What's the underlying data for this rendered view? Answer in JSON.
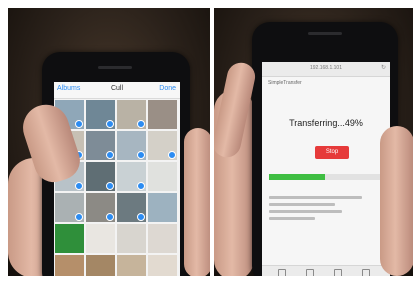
{
  "left_panel": {
    "nav": {
      "back_label": "Albums",
      "title": "Cull",
      "done_label": "Done"
    },
    "accent_color": "#2c8cf2",
    "photos": [
      {
        "color": "#8fa7b8",
        "checked": true
      },
      {
        "color": "#6f8796",
        "checked": true
      },
      {
        "color": "#b9b2a5",
        "checked": true
      },
      {
        "color": "#9a8f86",
        "checked": false
      },
      {
        "color": "#c7c0b4",
        "checked": true
      },
      {
        "color": "#7e8c97",
        "checked": true
      },
      {
        "color": "#a7b6c1",
        "checked": true
      },
      {
        "color": "#d4d0c8",
        "checked": true
      },
      {
        "color": "#b8c2c8",
        "checked": true
      },
      {
        "color": "#5f6e74",
        "checked": true
      },
      {
        "color": "#c9d1d4",
        "checked": true
      },
      {
        "color": "#e0e1de",
        "checked": false
      },
      {
        "color": "#aab1b3",
        "checked": true
      },
      {
        "color": "#8c8a85",
        "checked": true
      },
      {
        "color": "#6c7a80",
        "checked": true
      },
      {
        "color": "#9db2c0",
        "checked": false
      },
      {
        "color": "#2f8f3a",
        "checked": false
      },
      {
        "color": "#e9e6e1",
        "checked": false
      },
      {
        "color": "#d8d5cf",
        "checked": false
      },
      {
        "color": "#ddd8d2",
        "checked": false
      },
      {
        "color": "#b58f6a",
        "checked": false
      },
      {
        "color": "#a48765",
        "checked": false
      },
      {
        "color": "#c6b49b",
        "checked": false
      },
      {
        "color": "#e2dad0",
        "checked": false
      }
    ]
  },
  "right_panel": {
    "url": "192.168.1.101",
    "app_header": "SimpleTransfer",
    "headline": "Transferring...49%",
    "stop_label": "Stop",
    "progress_percent": 49,
    "progress_color": "#3fbe42",
    "stop_color": "#e63a3a"
  }
}
